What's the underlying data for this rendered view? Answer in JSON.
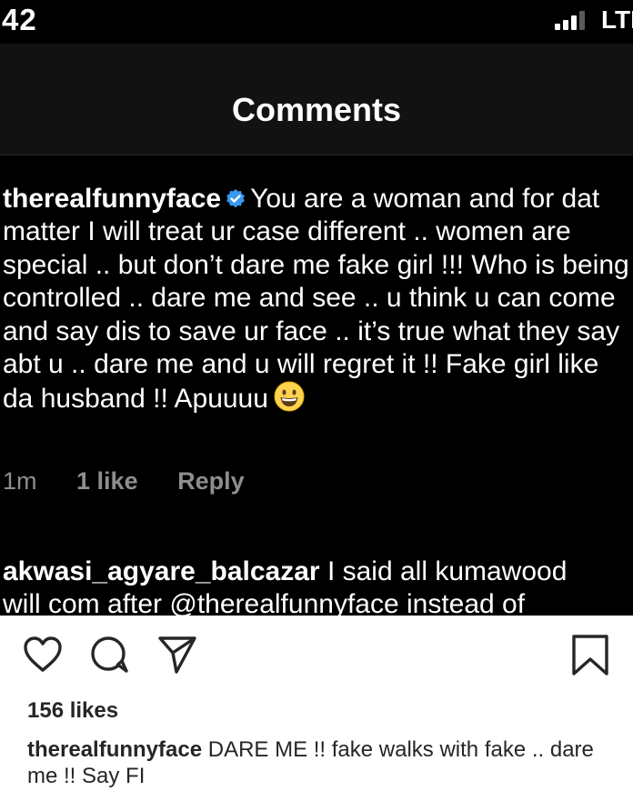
{
  "status_bar": {
    "time": "42",
    "network": "LTE"
  },
  "header": {
    "title": "Comments"
  },
  "comment": {
    "username": "therealfunnyface",
    "text": "You are a woman and for dat matter I will treat ur case different .. women are special .. but don’t dare me fake girl !!! Who is being controlled .. dare me and see .. u think u can come and say dis to save ur face .. it’s true what they say abt u .. dare me and u will regret it !! Fake girl like da husband !! Apuuuu",
    "time": "1m",
    "likes": "1 like",
    "reply_label": "Reply",
    "icons": [
      "verified-badge",
      "grinning-face-emoji"
    ]
  },
  "comment2": {
    "username": "akwasi_agyare_balcazar",
    "line1": "I said all kumawood",
    "line2": "will com after @therealfunnyface instead of"
  },
  "post": {
    "likes": "156 likes",
    "caption_username": "therealfunnyface",
    "caption_text": "DARE ME !! fake walks with fake .. dare me !! Say FI",
    "icons": [
      "heart-icon",
      "comment-icon",
      "share-icon",
      "bookmark-icon"
    ]
  }
}
